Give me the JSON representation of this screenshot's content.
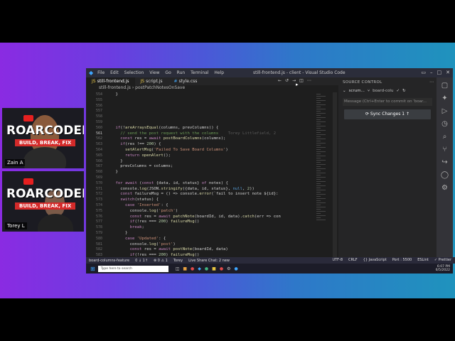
{
  "webcams": [
    {
      "name": "Zain A",
      "logo": "ROARCODERS",
      "tagline": "BUILD, BREAK, FIX"
    },
    {
      "name": "Torey L",
      "logo": "ROARCODERS",
      "tagline": "BUILD, BREAK, FIX"
    }
  ],
  "window": {
    "menu": [
      "File",
      "Edit",
      "Selection",
      "View",
      "Go",
      "Run",
      "Terminal",
      "Help"
    ],
    "title": "still-frontend.js - client - Visual Studio Code"
  },
  "tabs": [
    {
      "label": "still-frontend.js",
      "type": "js",
      "active": true
    },
    {
      "label": "script.js",
      "type": "js",
      "active": false
    },
    {
      "label": "style.css",
      "type": "css",
      "active": false
    }
  ],
  "breadcrumb": {
    "file": "still-frontend.js",
    "symbol": "postPatchNotesOnSave"
  },
  "line_numbers": [
    "554",
    "555",
    "556",
    "557",
    "558",
    "559",
    "560",
    "561",
    "562",
    "563",
    "564",
    "565",
    "566",
    "567",
    "568",
    "569",
    "570",
    "571",
    "572",
    "573",
    "574",
    "575",
    "576",
    "577",
    "578",
    "579",
    "580",
    "581",
    "582",
    "583"
  ],
  "current_line": "561",
  "code_lines": [
    "    }",
    "",
    "",
    "",
    "",
    "",
    "    if(!areArraysEqual(columns, prevColumns)) {",
    "      // send the post request with the columns",
    "      const res = await postBoardColumns(columns);",
    "      if(res !== 200) {",
    "        setAlertMsg('Failed To Save Board Columns')",
    "        return openAlert();",
    "      }",
    "      prevColumns = columns;",
    "    }",
    "",
    "    for await (const {data, id, status} of notes) {",
    "      console.log(JSON.stringify({data, id, status}, null, 2))",
    "      const failureMsg = () => console.error(`fail to insert note ${id}:",
    "      switch(status) {",
    "        case 'Inserted': {",
    "          console.log('patch')",
    "          const res = await patchNote(boardId, id, data).catch(err => con",
    "          if(!res === 200) failureMsg()",
    "          break;",
    "        }",
    "        case 'Updated': {",
    "          console.log('post')",
    "          const res = await postNote(boardId, data)",
    "          if(!res === 200) failureMsg()"
  ],
  "blame": "Torey Littlefield, 2",
  "source_control": {
    "header": "SOURCE CONTROL",
    "repo": "scrum...",
    "branch": "board-colu",
    "message_placeholder": "Message (Ctrl+Enter to commit on 'boar...",
    "sync_label": "Sync Changes 1"
  },
  "statusbar": {
    "left": [
      "board-columns-feature",
      "0 ↓ 1↑",
      "⊗ 0 ⚠ 1",
      "Torey",
      "Live Share Chat: 2 new"
    ],
    "right": [
      "UTF-8",
      "CRLF",
      "{} JavaScript",
      "Port : 5500",
      "ESLint",
      "✓ Prettier"
    ]
  },
  "taskbar": {
    "search_placeholder": "Type here to search",
    "time": "6:07 PM",
    "date": "6/5/2022"
  }
}
